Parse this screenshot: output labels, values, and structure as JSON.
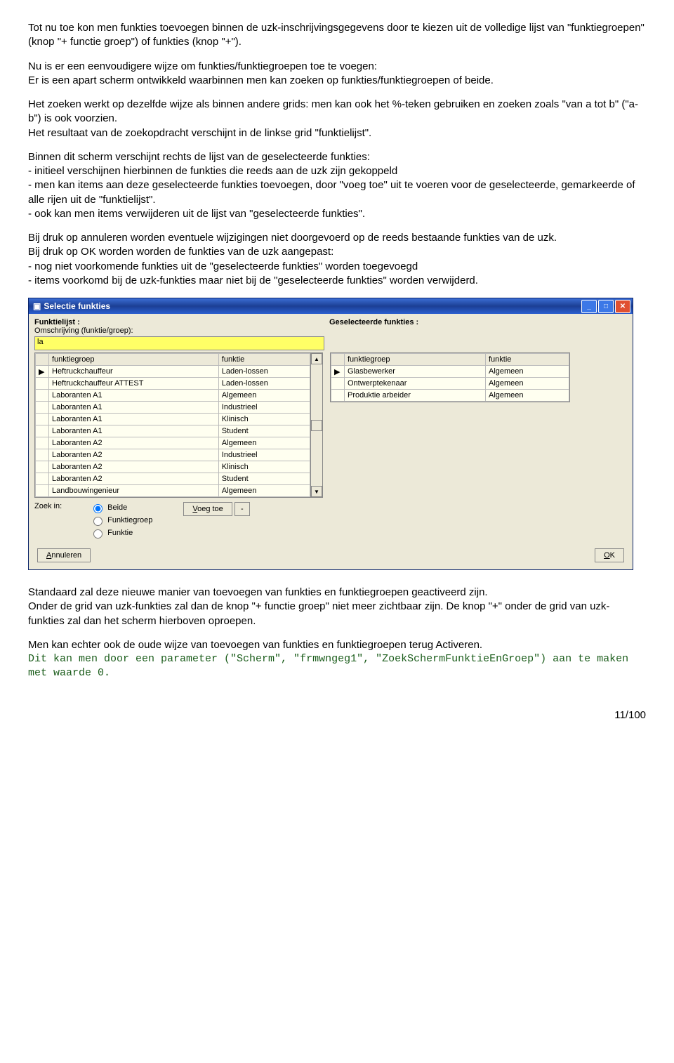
{
  "para1": "Tot nu toe kon men funkties toevoegen binnen de uzk-inschrijvingsgegevens door te kiezen uit de volledige lijst van \"funktiegroepen\" (knop \"+ functie groep\") of funkties (knop \"+\").",
  "para2": "Nu is er een eenvoudigere wijze om funkties/funktiegroepen toe te voegen:\nEr is een apart scherm ontwikkeld waarbinnen men kan zoeken op funkties/funktiegroepen of beide.",
  "para3a": "Het zoeken werkt op dezelfde wijze als binnen andere grids: men kan ook het %-teken gebruiken en zoeken zoals \"van a tot b\" (\"a-b\") is ook voorzien.",
  "para3b": "Het resultaat van de zoekopdracht verschijnt in de linkse grid \"funktielijst\".",
  "para4_intro": "Binnen dit scherm verschijnt rechts de lijst van de geselecteerde funkties:",
  "para4_b1": "- initieel verschijnen hierbinnen de funkties die reeds aan de uzk zijn gekoppeld",
  "para4_b2": "- men kan items aan deze geselecteerde funkties toevoegen, door \"voeg toe\" uit te voeren voor de geselecteerde, gemarkeerde of alle rijen uit de \"funktielijst\".",
  "para4_b3": "- ook kan men items verwijderen uit de lijst van \"geselecteerde funkties\".",
  "para5a": "Bij druk op annuleren worden eventuele wijzigingen niet doorgevoerd op de reeds bestaande funkties van de uzk.",
  "para5b": "Bij druk op OK worden worden de funkties van de uzk aangepast:",
  "para5_b1": "- nog niet voorkomende funkties uit de \"geselecteerde funkties\" worden toegevoegd",
  "para5_b2": "- items voorkomd bij de uzk-funkties maar niet bij de \"geselecteerde funkties\" worden verwijderd.",
  "para6a": "Standaard zal deze nieuwe manier van toevoegen van funkties en funktiegroepen geactiveerd zijn.",
  "para6b": "Onder de grid van uzk-funkties zal dan de knop \"+ functie groep\" niet meer zichtbaar zijn. De knop \"+\" onder de grid van uzk-funkties zal dan het scherm hierboven oproepen.",
  "para7": "Men kan echter ook de oude wijze van toevoegen van funkties en funktiegroepen terug Activeren.",
  "para8": "Dit kan men door een parameter (\"Scherm\", \"frmwngeg1\", \"ZoekSchermFunktieEnGroep\") aan te maken met waarde 0.",
  "pagenum": "11/100",
  "dialog": {
    "title": "Selectie funkties",
    "left_label": "Funktielijst :",
    "desc_label": "Omschrijving (funktie/groep):",
    "right_label": "Geselecteerde funkties :",
    "search_value": "la",
    "col_group": "funktiegroep",
    "col_funk": "funktie",
    "leftrows": [
      {
        "g": "Heftruckchauffeur",
        "f": "Laden-lossen"
      },
      {
        "g": "Heftruckchauffeur ATTEST",
        "f": "Laden-lossen"
      },
      {
        "g": "Laboranten A1",
        "f": "Algemeen"
      },
      {
        "g": "Laboranten A1",
        "f": "Industrieel"
      },
      {
        "g": "Laboranten A1",
        "f": "Klinisch"
      },
      {
        "g": "Laboranten A1",
        "f": "Student"
      },
      {
        "g": "Laboranten A2",
        "f": "Algemeen"
      },
      {
        "g": "Laboranten A2",
        "f": "Industrieel"
      },
      {
        "g": "Laboranten A2",
        "f": "Klinisch"
      },
      {
        "g": "Laboranten A2",
        "f": "Student"
      },
      {
        "g": "Landbouwingenieur",
        "f": "Algemeen"
      }
    ],
    "rightrows": [
      {
        "g": "Glasbewerker",
        "f": "Algemeen"
      },
      {
        "g": "Ontwerptekenaar",
        "f": "Algemeen"
      },
      {
        "g": "Produktie arbeider",
        "f": "Algemeen"
      }
    ],
    "zoekin": "Zoek in:",
    "radio_beide": "Beide",
    "radio_group": "Funktiegroep",
    "radio_funk": "Funktie",
    "voegtoe": "Voeg toe",
    "minus": "-",
    "annuleren": "Annuleren",
    "ok": "OK"
  }
}
